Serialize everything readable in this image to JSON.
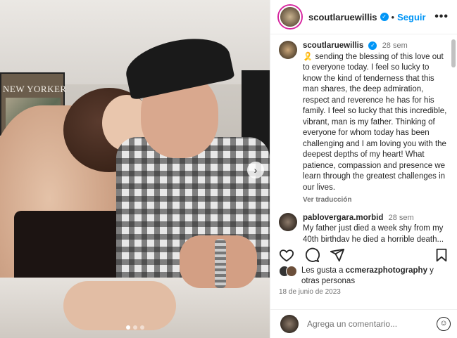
{
  "post": {
    "username": "scoutlaruewillis",
    "follow_label": "Seguir",
    "separator": "•",
    "more": "•••",
    "carousel": {
      "count": 3,
      "active": 1
    }
  },
  "poster_text": "NEW YORKER",
  "comments": [
    {
      "user": "scoutlaruewillis",
      "time": "28 sem",
      "text": "🎗️ sending the blessing of this love out to everyone today. I feel so lucky to know the kind of tenderness that this man shares, the deep admiration, respect and reverence he has for his family. I feel so lucky that this incredible, vibrant, man is my father. Thinking of everyone for whom today has been challenging and I am loving you with the deepest depths of my heart! What patience, compassion and presence we learn through the greatest challenges in our lives.",
      "translate": "Ver traducción"
    },
    {
      "user": "pablovergara.morbid",
      "time": "28 sem",
      "text": "My father just died a week shy from my 40th birthday he died a horrible death... then some weeks"
    }
  ],
  "likes": {
    "prefix": "Les gusta a ",
    "user": "ccmerazphotography",
    "suffix": " y otras personas"
  },
  "date": "18 de junio de 2023",
  "add_comment": {
    "placeholder": "Agrega un comentario..."
  },
  "colors": {
    "accent": "#0095f6",
    "text": "#262626",
    "muted": "#737373"
  }
}
